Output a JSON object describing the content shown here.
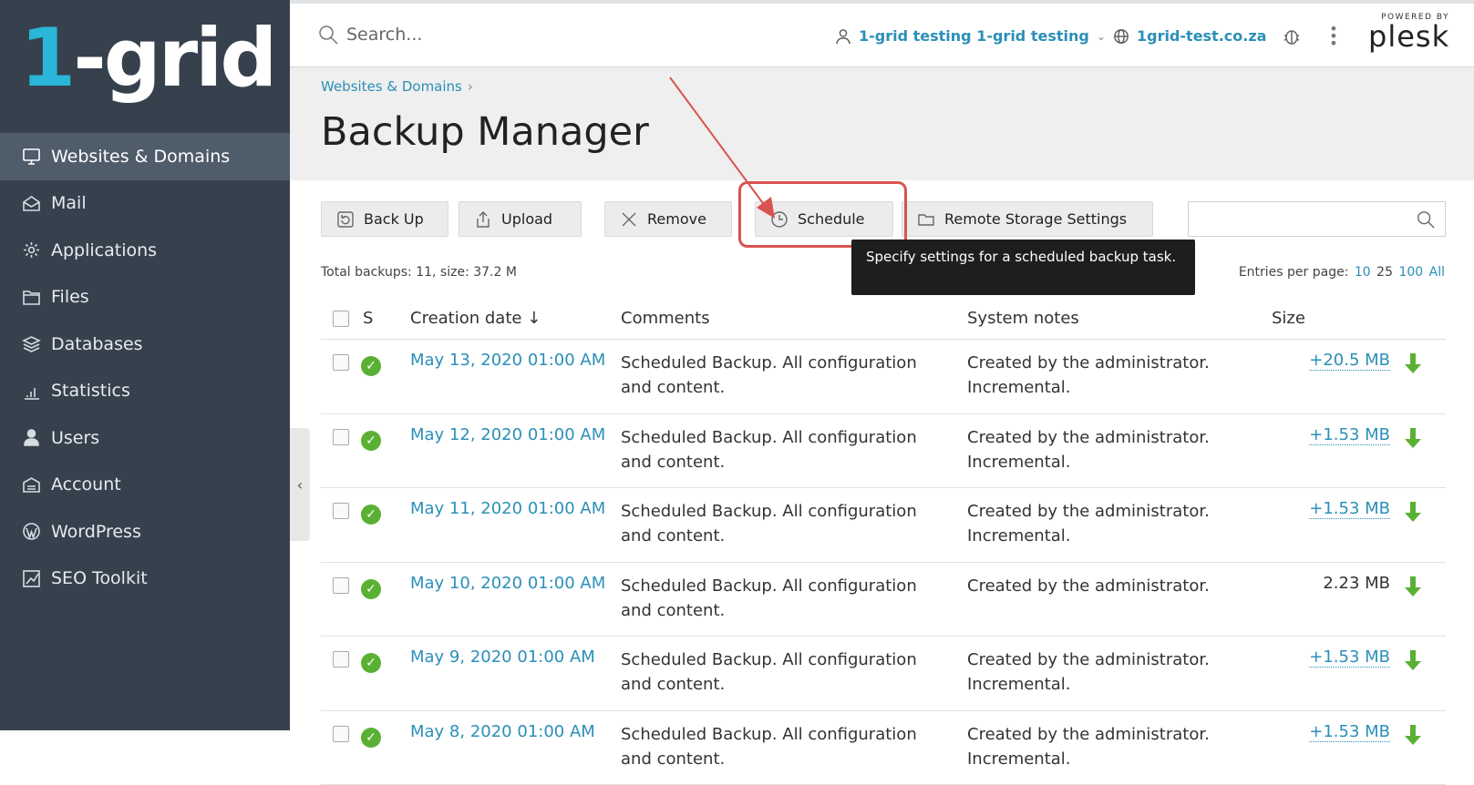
{
  "brand": {
    "logo_one": "1",
    "logo_rest": "-grid"
  },
  "sidebar": {
    "items": [
      {
        "label": "Websites & Domains",
        "icon": "monitor-icon",
        "active": true
      },
      {
        "label": "Mail",
        "icon": "mail-icon"
      },
      {
        "label": "Applications",
        "icon": "gear-icon"
      },
      {
        "label": "Files",
        "icon": "folder-icon"
      },
      {
        "label": "Databases",
        "icon": "database-icon"
      },
      {
        "label": "Statistics",
        "icon": "bar-chart-icon"
      },
      {
        "label": "Users",
        "icon": "user-icon"
      },
      {
        "label": "Account",
        "icon": "account-icon"
      },
      {
        "label": "WordPress",
        "icon": "wordpress-icon"
      },
      {
        "label": "SEO Toolkit",
        "icon": "seo-chart-icon"
      }
    ],
    "collapse_glyph": "‹"
  },
  "topbar": {
    "search_placeholder": "Search...",
    "user_label": "1-grid testing 1-grid testing",
    "domain_label": "1grid-test.co.za",
    "powered_by": "POWERED BY",
    "plesk": "plesk"
  },
  "header": {
    "breadcrumb": "Websites & Domains",
    "breadcrumb_sep": "›",
    "title": "Backup Manager"
  },
  "toolbar": {
    "backup": "Back Up",
    "upload": "Upload",
    "remove": "Remove",
    "schedule": "Schedule",
    "remote": "Remote Storage Settings"
  },
  "tooltip": "Specify settings for a scheduled backup task.",
  "summary": {
    "total": "Total backups: 11, size: 37.2 M",
    "entries_label": "Entries per page:",
    "entries_options": [
      "10",
      "25",
      "100",
      "All"
    ]
  },
  "table": {
    "headers": {
      "status": "S",
      "date": "Creation date ↓",
      "comments": "Comments",
      "notes": "System notes",
      "size": "Size"
    },
    "rows": [
      {
        "date": "May 13, 2020 01:00 AM",
        "comments": "Scheduled Backup. All configuration and content.",
        "notes": "Created by the administrator. Incremental.",
        "size": "+20.5 MB",
        "incremental": true
      },
      {
        "date": "May 12, 2020 01:00 AM",
        "comments": "Scheduled Backup. All configuration and content.",
        "notes": "Created by the administrator. Incremental.",
        "size": "+1.53 MB",
        "incremental": true
      },
      {
        "date": "May 11, 2020 01:00 AM",
        "comments": "Scheduled Backup. All configuration and content.",
        "notes": "Created by the administrator. Incremental.",
        "size": "+1.53 MB",
        "incremental": true
      },
      {
        "date": "May 10, 2020 01:00 AM",
        "comments": "Scheduled Backup. All configuration and content.",
        "notes": "Created by the administrator.",
        "size": "2.23 MB",
        "incremental": false
      },
      {
        "date": "May 9, 2020 01:00 AM",
        "comments": "Scheduled Backup. All configuration and content.",
        "notes": "Created by the administrator. Incremental.",
        "size": "+1.53 MB",
        "incremental": true
      },
      {
        "date": "May 8, 2020 01:00 AM",
        "comments": "Scheduled Backup. All configuration and content.",
        "notes": "Created by the administrator. Incremental.",
        "size": "+1.53 MB",
        "incremental": true
      }
    ]
  },
  "colors": {
    "sidebar": "#36414d",
    "active": "#4f5c6a",
    "link": "#2b8fb8",
    "ok": "#5ab033",
    "highlight": "#d9534f"
  }
}
